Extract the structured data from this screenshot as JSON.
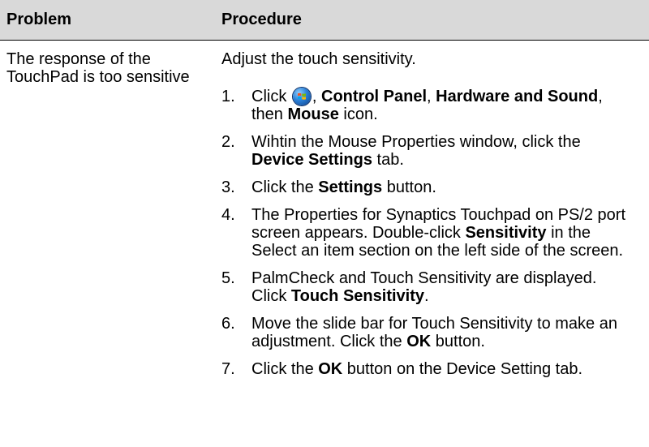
{
  "header": {
    "problem_label": "Problem",
    "procedure_label": "Procedure"
  },
  "problem_text": "The response of the TouchPad is too sensitive",
  "intro_text": "Adjust the touch sensitivity.",
  "steps": [
    {
      "num": "1.",
      "parts": [
        "Click ",
        "",
        ", ",
        "Control Panel",
        ", ",
        "Hardware and Sound",
        ", then ",
        "Mouse",
        " icon."
      ]
    },
    {
      "num": "2.",
      "parts": [
        "Wihtin the Mouse Properties window, click the ",
        "Device Settings",
        " tab."
      ]
    },
    {
      "num": "3.",
      "parts": [
        "Click the ",
        "Settings",
        " button."
      ]
    },
    {
      "num": "4.",
      "parts": [
        "The Properties for Synaptics Touchpad on PS/2 port screen appears. Double-click ",
        "Sensitivity",
        " in the Select an item section on the left side of the screen."
      ]
    },
    {
      "num": "5.",
      "parts": [
        "PalmCheck and Touch Sensitivity are displayed. Click ",
        "Touch Sensitivity",
        "."
      ]
    },
    {
      "num": "6.",
      "parts": [
        "Move the slide bar for Touch Sensitivity to make an adjustment. Click the ",
        "OK",
        " button."
      ]
    },
    {
      "num": "7.",
      "parts": [
        "Click the ",
        "OK",
        " button on the Device Setting tab."
      ]
    }
  ],
  "icons": {
    "start_button": "windows-start-orb-icon"
  },
  "colors": {
    "header_background": "#d9d9d9",
    "text": "#000000"
  }
}
